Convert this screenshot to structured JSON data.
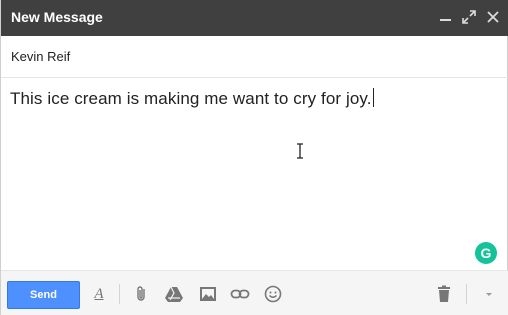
{
  "window": {
    "title": "New Message"
  },
  "titlebar": {
    "minimize_icon": "minimize-icon",
    "popout_icon": "popout-icon",
    "close_icon": "close-icon"
  },
  "recipient": {
    "name": "Kevin Reif"
  },
  "body": {
    "text": "This ice cream is making me want to cry for joy."
  },
  "grammarly": {
    "label": "G",
    "color": "#15c39a"
  },
  "toolbar": {
    "send_label": "Send",
    "send_color": "#4d90fe",
    "icons": [
      "formatting-icon",
      "attach-icon",
      "drive-icon",
      "photo-icon",
      "link-icon",
      "emoji-icon",
      "trash-icon",
      "more-options-icon"
    ]
  },
  "colors": {
    "titlebar": "#404040",
    "toolbar": "#f5f5f5"
  }
}
